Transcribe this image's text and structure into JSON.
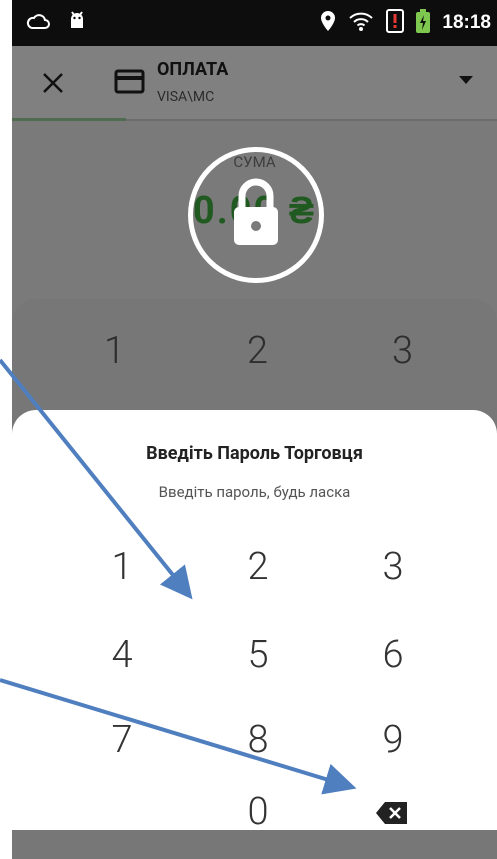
{
  "status_bar": {
    "time": "18:18"
  },
  "app_bar": {
    "title": "ОПЛАТА",
    "subtitle": "VISA\\MC"
  },
  "summary": {
    "label": "СУМА",
    "value": "0.00 ₴"
  },
  "background_keypad": {
    "keys": [
      "1",
      "2",
      "3"
    ]
  },
  "dialog": {
    "title": "Введіть Пароль Торговця",
    "subtitle": "Введіть пароль, будь ласка",
    "keys": [
      "1",
      "2",
      "3",
      "4",
      "5",
      "6",
      "7",
      "8",
      "9",
      "0"
    ]
  },
  "colors": {
    "arrow": "#4f7fbf",
    "sum_green": "#215a21"
  }
}
